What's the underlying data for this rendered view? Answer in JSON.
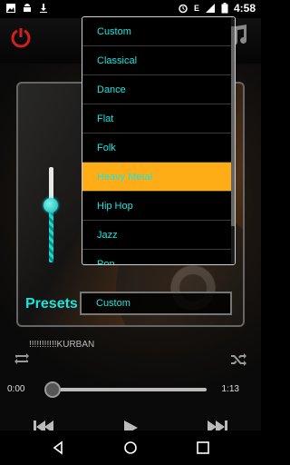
{
  "status_bar": {
    "time": "4:58",
    "data_indicator": "E",
    "icons": [
      "gallery-icon",
      "android-icon",
      "download-icon",
      "alarm-icon",
      "signal-icon",
      "battery-icon"
    ]
  },
  "equalizer": {
    "presets_label": "Presets",
    "current_preset": "Custom",
    "level_percent": 60
  },
  "dropdown": {
    "options": [
      "Custom",
      "Classical",
      "Dance",
      "Flat",
      "Folk",
      "Heavy Metal",
      "Hip Hop",
      "Jazz",
      "Pop"
    ],
    "selected_index": 5
  },
  "player": {
    "track_title": "!!!!!!!!!!!KURBAN",
    "time_elapsed": "0:00",
    "time_total": "1:13",
    "progress_fraction": 0.0
  },
  "colors": {
    "accent": "#19e6de",
    "selected_bg": "#ffad17",
    "power_red": "#d21f1f"
  }
}
